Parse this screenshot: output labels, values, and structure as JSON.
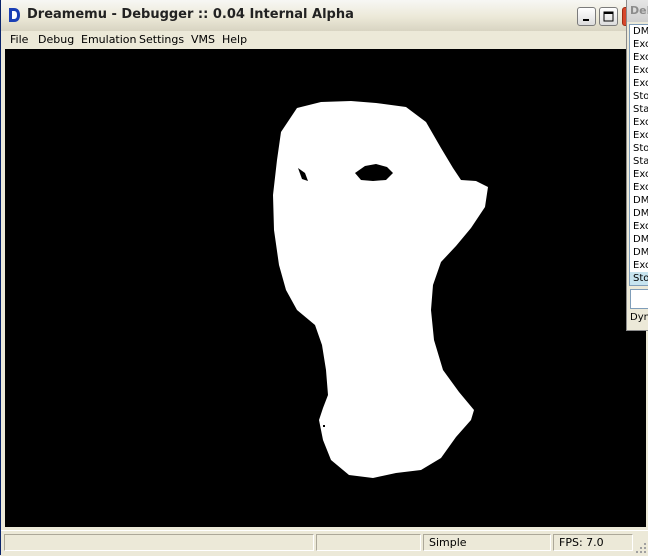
{
  "window": {
    "title": "Dreamemu - Debugger :: 0.04 Internal Alpha",
    "icons": {
      "app": "dreamemu-logo-icon",
      "minimize": "minimize-icon",
      "maximize": "maximize-icon",
      "close": "close-icon"
    },
    "colors": {
      "app_icon": "#1a3fb5",
      "close": "#d7482c",
      "render_bg": "#000000",
      "model": "#ffffff"
    }
  },
  "menu": {
    "items": [
      "File",
      "Debug",
      "Emulation",
      "Settings",
      "VMS",
      "Help"
    ]
  },
  "statusbar": {
    "mode": "Simple",
    "fps": "FPS: 7.0"
  },
  "debugger_window": {
    "title": "Deb",
    "log_rows": [
      "DMA",
      "Exc",
      "Exc",
      "Exc",
      "Exc",
      "Sto",
      "Sta",
      "Exc",
      "Exc",
      "Sto",
      "Sta",
      "Exc",
      "Exc",
      "DMA",
      "DMA",
      "Exc",
      "DMA",
      "DMA",
      "Exc",
      "Sto"
    ],
    "selected_row": 19,
    "footer": "Dyn"
  }
}
